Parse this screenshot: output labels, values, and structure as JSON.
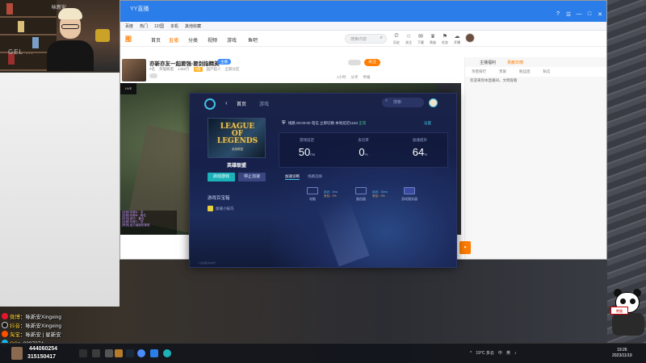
{
  "browser": {
    "title_url": "YY直播",
    "window_controls": [
      "?",
      "☰",
      "—",
      "□",
      "✕"
    ],
    "bookmarks": [
      "百度",
      "热门",
      "12/国",
      "",
      "",
      "",
      "本机",
      "其他收藏"
    ]
  },
  "site": {
    "logo": "图",
    "nav": [
      "首页",
      "直播",
      "分类",
      "视频",
      "游戏",
      "鱼吧"
    ],
    "search_placeholder": "搜索内容",
    "icons": [
      {
        "glyph": "⏲",
        "label": "历史"
      },
      {
        "glyph": "☆",
        "label": "关注"
      },
      {
        "glyph": "✉",
        "label": "下载"
      },
      {
        "glyph": "♛",
        "label": "贵族"
      },
      {
        "glyph": "⚑",
        "label": "任务"
      },
      {
        "glyph": "☁",
        "label": "开播"
      }
    ]
  },
  "room": {
    "title": "亦新亦友一起要强-要剑指精英",
    "badge": "主播",
    "meta": [
      "#名",
      "英雄联盟",
      "1468万",
      "5级",
      "国产超人",
      "全部分区"
    ],
    "stats": [
      "1小时",
      "分享",
      "举报"
    ],
    "follow_label": "关注"
  },
  "side_panel": {
    "tabs": [
      "主播福利",
      "贡献日榜"
    ],
    "tabs2": [
      "亲密排行",
      "贵族",
      "粉丝团",
      "私信"
    ],
    "notice": "欢迎来到本直播间，文明观看"
  },
  "video": {
    "minimap_tag": "LIVE",
    "chat_lines": [
      "[全部] 玩家A：冲",
      "[全部] 玩家B：稳住",
      "[队伍] 我方：集合",
      "[全部] 玩家C：好",
      "[系统] 敌方摧毁防御塔"
    ]
  },
  "launcher": {
    "tabs": [
      "首页",
      "游戏"
    ],
    "back": "‹",
    "search_placeholder": "搜索",
    "game_cover_title": "LEAGUE OF LEGENDS",
    "game_cover_sub": "英雄联盟",
    "game_name": "英雄联盟",
    "btn_start": "启动游戏",
    "btn_speed": "停止加速",
    "tools_title": "游戏百宝箱",
    "tool_item": "加速小技巧",
    "status": "线路 00:00:00  电信 立即切换  本地延迟1163",
    "status_ok": "正常",
    "settings": "设置",
    "metrics": [
      {
        "label": "游戏延迟",
        "value": "50",
        "unit": "ms"
      },
      {
        "label": "丢包率",
        "value": "0",
        "unit": "%"
      },
      {
        "label": "加速提升",
        "value": "64",
        "unit": "%"
      }
    ],
    "diag_tabs": [
      "加速诊断",
      "线路选择"
    ],
    "diag_nodes": [
      "电脑",
      "路由器",
      "游戏服务器"
    ],
    "diag_links": [
      {
        "line1": "延迟：0ms",
        "line2": "丢包：0%"
      },
      {
        "line1": "延迟：30ms",
        "line2": "丢包：0%"
      }
    ],
    "bottom_note": "© 加速器 版本号"
  },
  "social": [
    {
      "platform": "微博",
      "text": "咏新安Xingxing",
      "color": "#e6162d"
    },
    {
      "platform": "抖音",
      "text": "咏新安Xingxing",
      "color": "#111111"
    },
    {
      "platform": "淘宝",
      "text": "咏新安 | 星新安",
      "color": "#ff5000"
    },
    {
      "platform": "QQ",
      "text": "2297274",
      "color": "#12b7f5"
    }
  ],
  "counter": {
    "line1": "444060254",
    "line2": "315150417"
  },
  "taskbar": {
    "tray": [
      "^",
      "19°C 多云",
      "中",
      "英",
      "♪"
    ],
    "time": "19:26",
    "date": "2023/11/19"
  },
  "mascot": {
    "sign": "熊猫"
  },
  "webcam": {
    "shirt_text": "GEL ...",
    "sign": "咏新安"
  }
}
